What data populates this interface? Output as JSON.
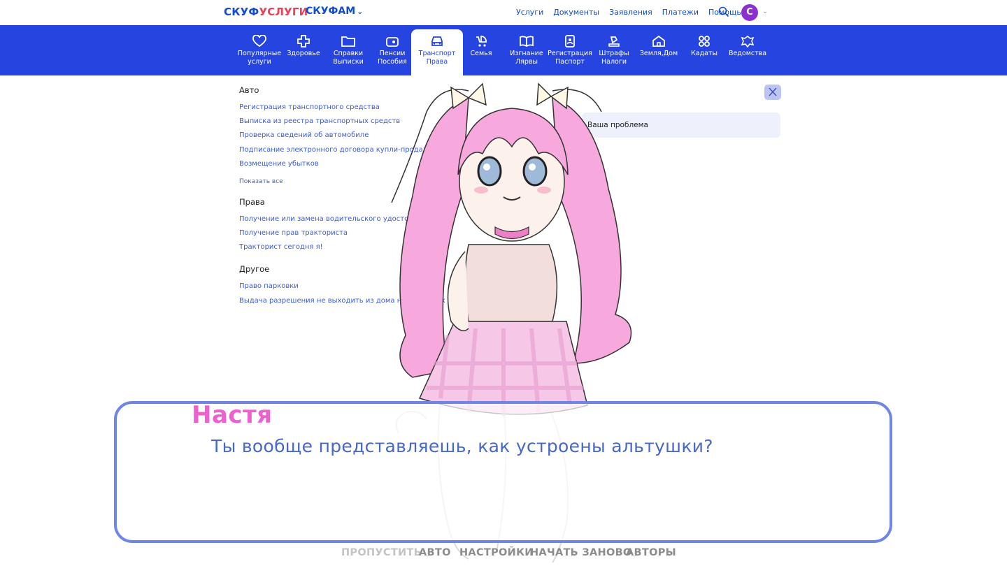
{
  "header": {
    "logo_part1": "СКУФ",
    "logo_part2": "УСЛУГИ",
    "fam": "СКУФАМ",
    "nav": [
      "Услуги",
      "Документы",
      "Заявления",
      "Платежи",
      "Помощь"
    ],
    "avatar_letter": "С"
  },
  "categories": [
    {
      "line1": "Популярные",
      "line2": "услуги",
      "icon": "heart-icon"
    },
    {
      "line1": "Здоровье",
      "line2": "",
      "icon": "health-cross-icon"
    },
    {
      "line1": "Справки",
      "line2": "Выписки",
      "icon": "folder-icon"
    },
    {
      "line1": "Пенсии",
      "line2": "Пособия",
      "icon": "wallet-icon"
    },
    {
      "line1": "Транспорт",
      "line2": "Права",
      "icon": "car-icon"
    },
    {
      "line1": "Семья",
      "line2": "",
      "icon": "stroller-icon"
    },
    {
      "line1": "Изгнание",
      "line2": "Лярвы",
      "icon": "book-icon"
    },
    {
      "line1": "Регистрация",
      "line2": "Паспорт",
      "icon": "id-card-icon"
    },
    {
      "line1": "Штрафы",
      "line2": "Налоги",
      "icon": "gavel-icon"
    },
    {
      "line1": "Земля,Дом",
      "line2": "",
      "icon": "house-icon"
    },
    {
      "line1": "Кадаты",
      "line2": "",
      "icon": "grid-icon"
    },
    {
      "line1": "Ведомства",
      "line2": "",
      "icon": "emblem-icon"
    }
  ],
  "menu": {
    "sections": [
      {
        "title": "Авто",
        "links": [
          "Регистрация транспортного средства",
          "Выписка из реестра транспортных средств",
          "Проверка сведений об автомобиле",
          "Подписание электронного договора купли-продажи",
          "Возмещение убытков"
        ],
        "show_all": "Показать все"
      },
      {
        "title": "Права",
        "links": [
          "Получение или замена водительского удостоверения",
          "Получение прав тракториста",
          "Тракторист сегодня  я!"
        ]
      },
      {
        "title": "Другое",
        "links": [
          "Право парковки",
          "Выдача разрешения не выходить из дома на выходных"
        ]
      }
    ],
    "problem_placeholder": "Ваша проблема"
  },
  "dialogue": {
    "speaker": "Настя",
    "text": "Ты вообще представляешь, как устроены альтушки?"
  },
  "quick_menu": [
    "ПРОПУСТИТЬ",
    "АВТО",
    "НАСТРОЙКИ",
    "НАЧАТЬ ЗАНОВО",
    "АВТОРЫ"
  ],
  "colors": {
    "brand_blue": "#2645e0",
    "speaker_pink": "#ee5fcf",
    "dialog_text": "#4768c9",
    "dialog_border": "#6f86e3"
  }
}
